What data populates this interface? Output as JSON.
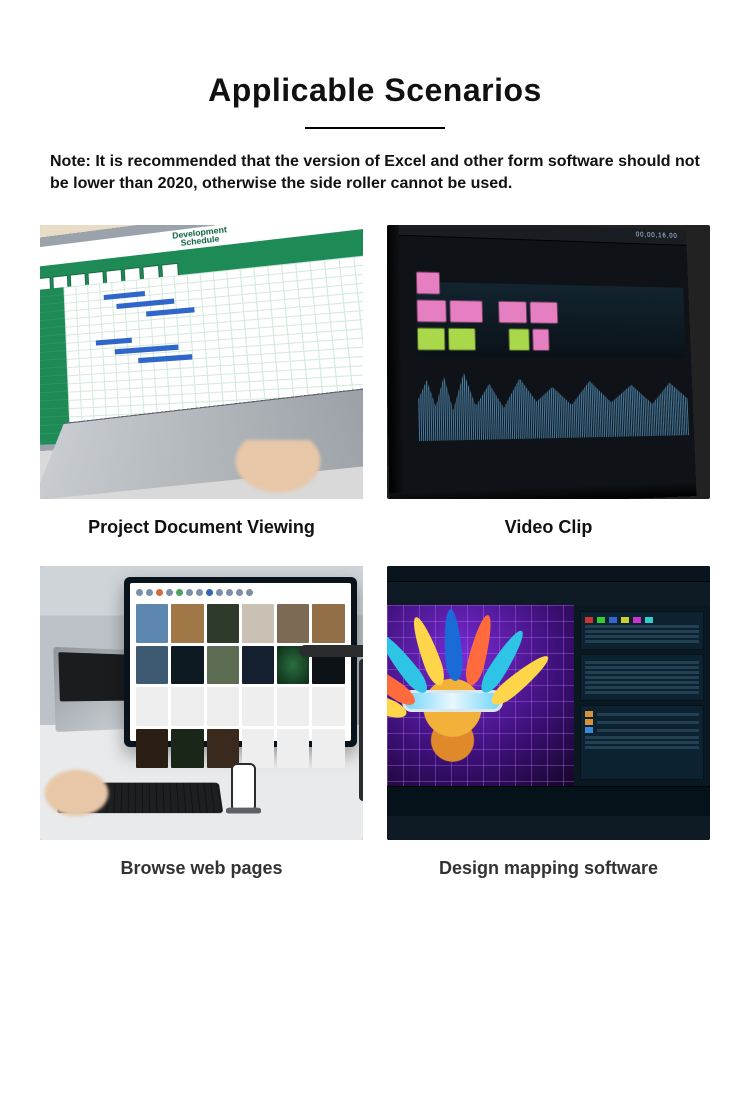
{
  "header": {
    "title": "Applicable Scenarios",
    "note_label": "Note:",
    "note_text": "It is recommended that the version of Excel and other form software should not be lower than 2020, otherwise the side roller cannot be used."
  },
  "cards": [
    {
      "caption": "Project Document Viewing",
      "screen_title_line1": "Development",
      "screen_title_line2": "Schedule"
    },
    {
      "caption": "Video Clip",
      "timecode": "00,00,16,00"
    },
    {
      "caption": "Browse web pages"
    },
    {
      "caption": "Design mapping software"
    }
  ]
}
